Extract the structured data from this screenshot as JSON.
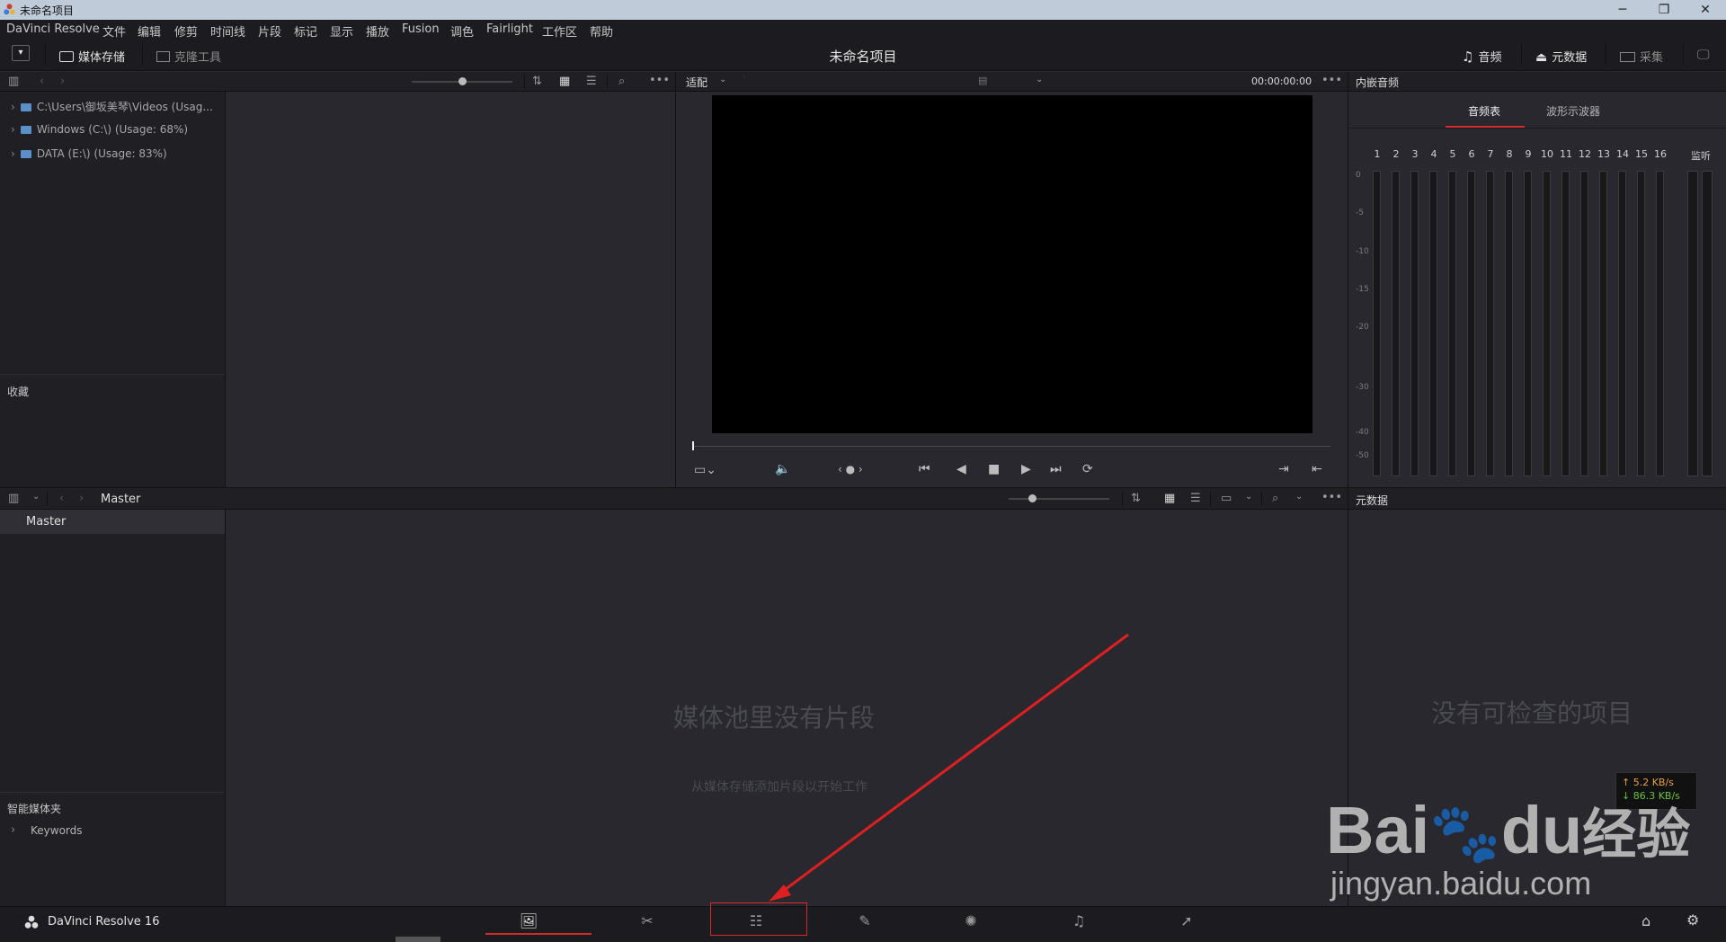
{
  "window": {
    "title": "未命名项目",
    "minimize": "─",
    "restore": "❐",
    "close": "✕"
  },
  "menu": [
    "DaVinci Resolve",
    "文件",
    "编辑",
    "修剪",
    "时间线",
    "片段",
    "标记",
    "显示",
    "播放",
    "Fusion",
    "调色",
    "Fairlight",
    "工作区",
    "帮助"
  ],
  "toolbar": {
    "media_storage": "媒体存储",
    "clone_tool": "克隆工具",
    "project_name": "未命名项目",
    "audio": "音频",
    "metadata": "元数据",
    "capture": "采集"
  },
  "storage": {
    "items": [
      "C:\\Users\\御坂美琴\\Videos (Usag...",
      "Windows (C:\\) (Usage: 68%)",
      "DATA (E:\\) (Usage: 83%)"
    ],
    "favorites_title": "收藏"
  },
  "viewer": {
    "fit_label": "适配",
    "timecode": "00:00:00:00"
  },
  "audio_panel": {
    "title": "内嵌音频",
    "tab_meters": "音频表",
    "tab_waveform": "波形示波器",
    "channels": [
      "1",
      "2",
      "3",
      "4",
      "5",
      "6",
      "7",
      "8",
      "9",
      "10",
      "11",
      "12",
      "13",
      "14",
      "15",
      "16"
    ],
    "monitor_label": "监听",
    "db_scale": [
      "0",
      "-5",
      "-10",
      "-15",
      "-20",
      "-30",
      "-40",
      "-50"
    ]
  },
  "media_pool": {
    "breadcrumb": "Master",
    "bin_master": "Master",
    "smart_bins_title": "智能媒体夹",
    "keywords": "Keywords",
    "empty_title": "媒体池里没有片段",
    "empty_hint": "从媒体存储添加片段以开始工作"
  },
  "metadata_panel": {
    "title": "元数据",
    "empty": "没有可检查的项目"
  },
  "footer": {
    "app_name": "DaVinci Resolve 16",
    "pages": [
      "media-page-icon",
      "cut-page-icon",
      "edit-page-icon",
      "fusion-page-icon",
      "color-page-icon",
      "fairlight-page-icon",
      "deliver-page-icon"
    ]
  },
  "overlay": {
    "upload_speed": "↑ 5.2 KB/s",
    "download_speed": "↓ 86.3 KB/s",
    "watermark_brand": "Bai",
    "watermark_du": "du",
    "watermark_cn": "经验",
    "watermark_url": "jingyan.baidu.com"
  },
  "colors": {
    "accent_red": "#d32b2b",
    "background": "#28282e",
    "header": "#1f1f24"
  }
}
